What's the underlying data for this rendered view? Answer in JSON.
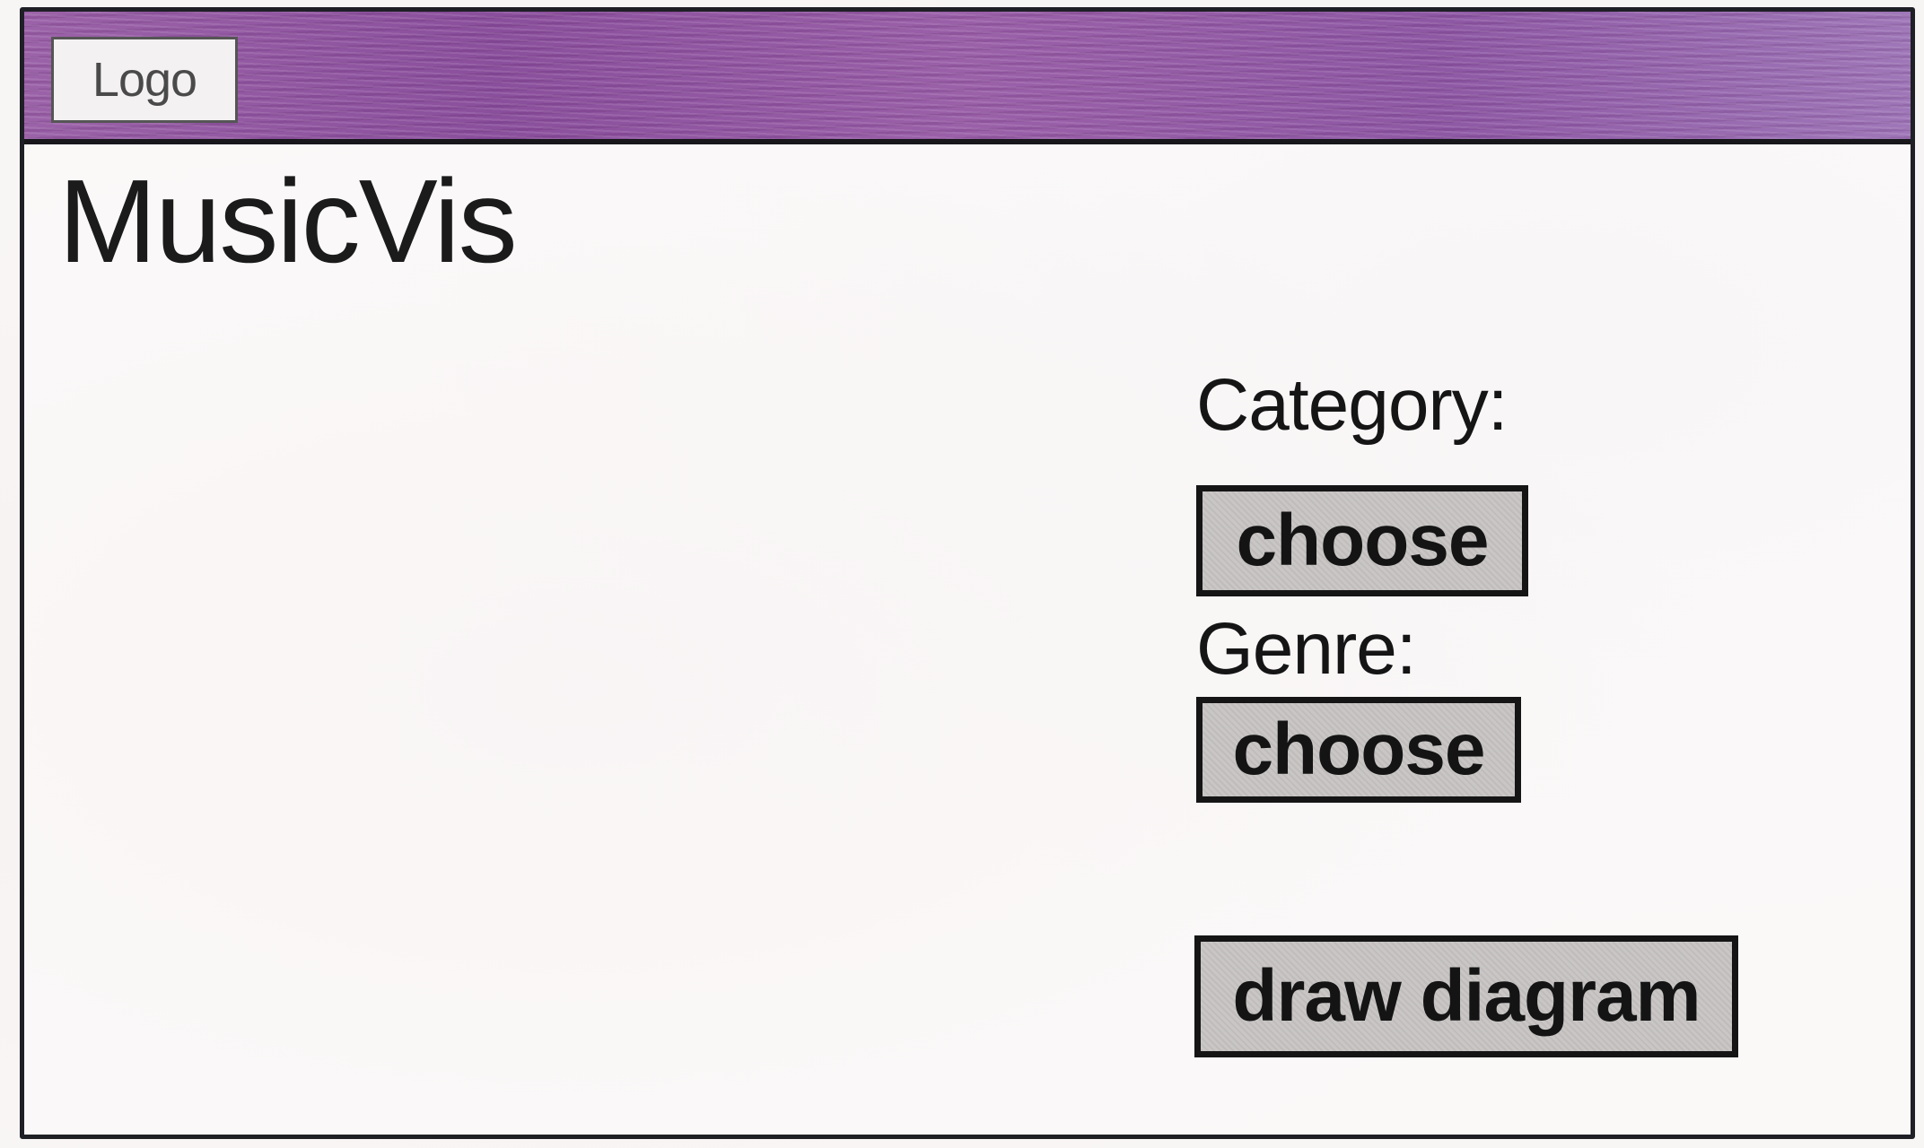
{
  "header": {
    "logo_text": "Logo"
  },
  "app": {
    "title": "MusicVis"
  },
  "controls": {
    "category": {
      "label": "Category:",
      "value": "choose"
    },
    "genre": {
      "label": "Genre:",
      "value": "choose"
    },
    "draw_button_label": "draw diagram"
  },
  "colors": {
    "header_accent": "#8e58a4",
    "button_fill": "#c9c6c5",
    "outline": "#151515"
  }
}
